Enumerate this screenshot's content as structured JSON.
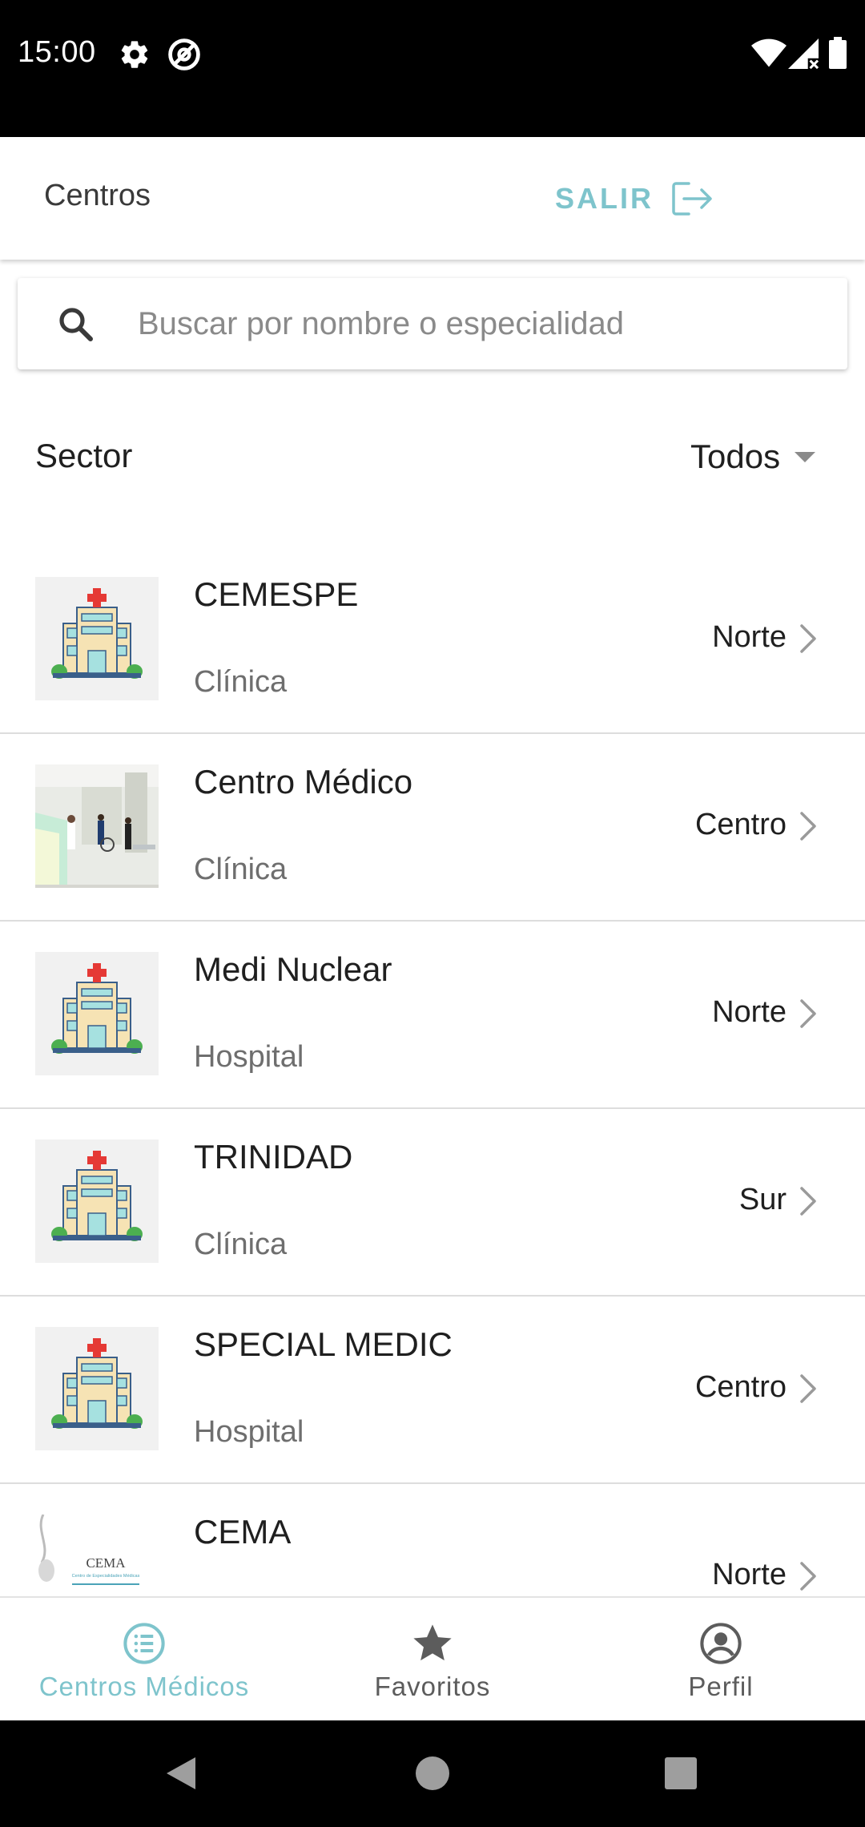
{
  "status_bar": {
    "time": "15:00",
    "icons": [
      "settings-icon",
      "at-sign-icon",
      "wifi-icon",
      "signal-icon",
      "battery-icon"
    ]
  },
  "app_bar": {
    "title": "Centros",
    "logout_label": "SALIR",
    "logout_icon": "logout-icon"
  },
  "search": {
    "placeholder": "Buscar por nombre o especialidad",
    "value": ""
  },
  "filter": {
    "label": "Sector",
    "selected": "Todos"
  },
  "centers": [
    {
      "name": "CEMESPE",
      "type": "Clínica",
      "zone": "Norte",
      "thumb": "hospital-building"
    },
    {
      "name": "Centro Médico",
      "type": "Clínica",
      "zone": "Centro",
      "thumb": "clinic-photo"
    },
    {
      "name": "Medi Nuclear",
      "type": "Hospital",
      "zone": "Norte",
      "thumb": "hospital-building"
    },
    {
      "name": "TRINIDAD",
      "type": "Clínica",
      "zone": "Sur",
      "thumb": "hospital-building"
    },
    {
      "name": "SPECIAL MEDIC",
      "type": "Hospital",
      "zone": "Centro",
      "thumb": "hospital-building"
    },
    {
      "name": "CEMA",
      "type": "",
      "zone": "Norte",
      "thumb": "cema-logo",
      "logo_text": "CEMA",
      "logo_subtext": "Centro de Especialidades Médicas"
    }
  ],
  "bottom_nav": {
    "items": [
      {
        "label": "Centros Médicos",
        "icon": "list-icon",
        "active": true
      },
      {
        "label": "Favoritos",
        "icon": "star-icon",
        "active": false
      },
      {
        "label": "Perfil",
        "icon": "profile-icon",
        "active": false
      }
    ]
  },
  "colors": {
    "accent": "#7ec4cc",
    "status_bar": "#000000",
    "text_primary": "#1f1f1f",
    "text_secondary": "#6e6e6e",
    "inactive_nav": "#5c5c5c"
  }
}
